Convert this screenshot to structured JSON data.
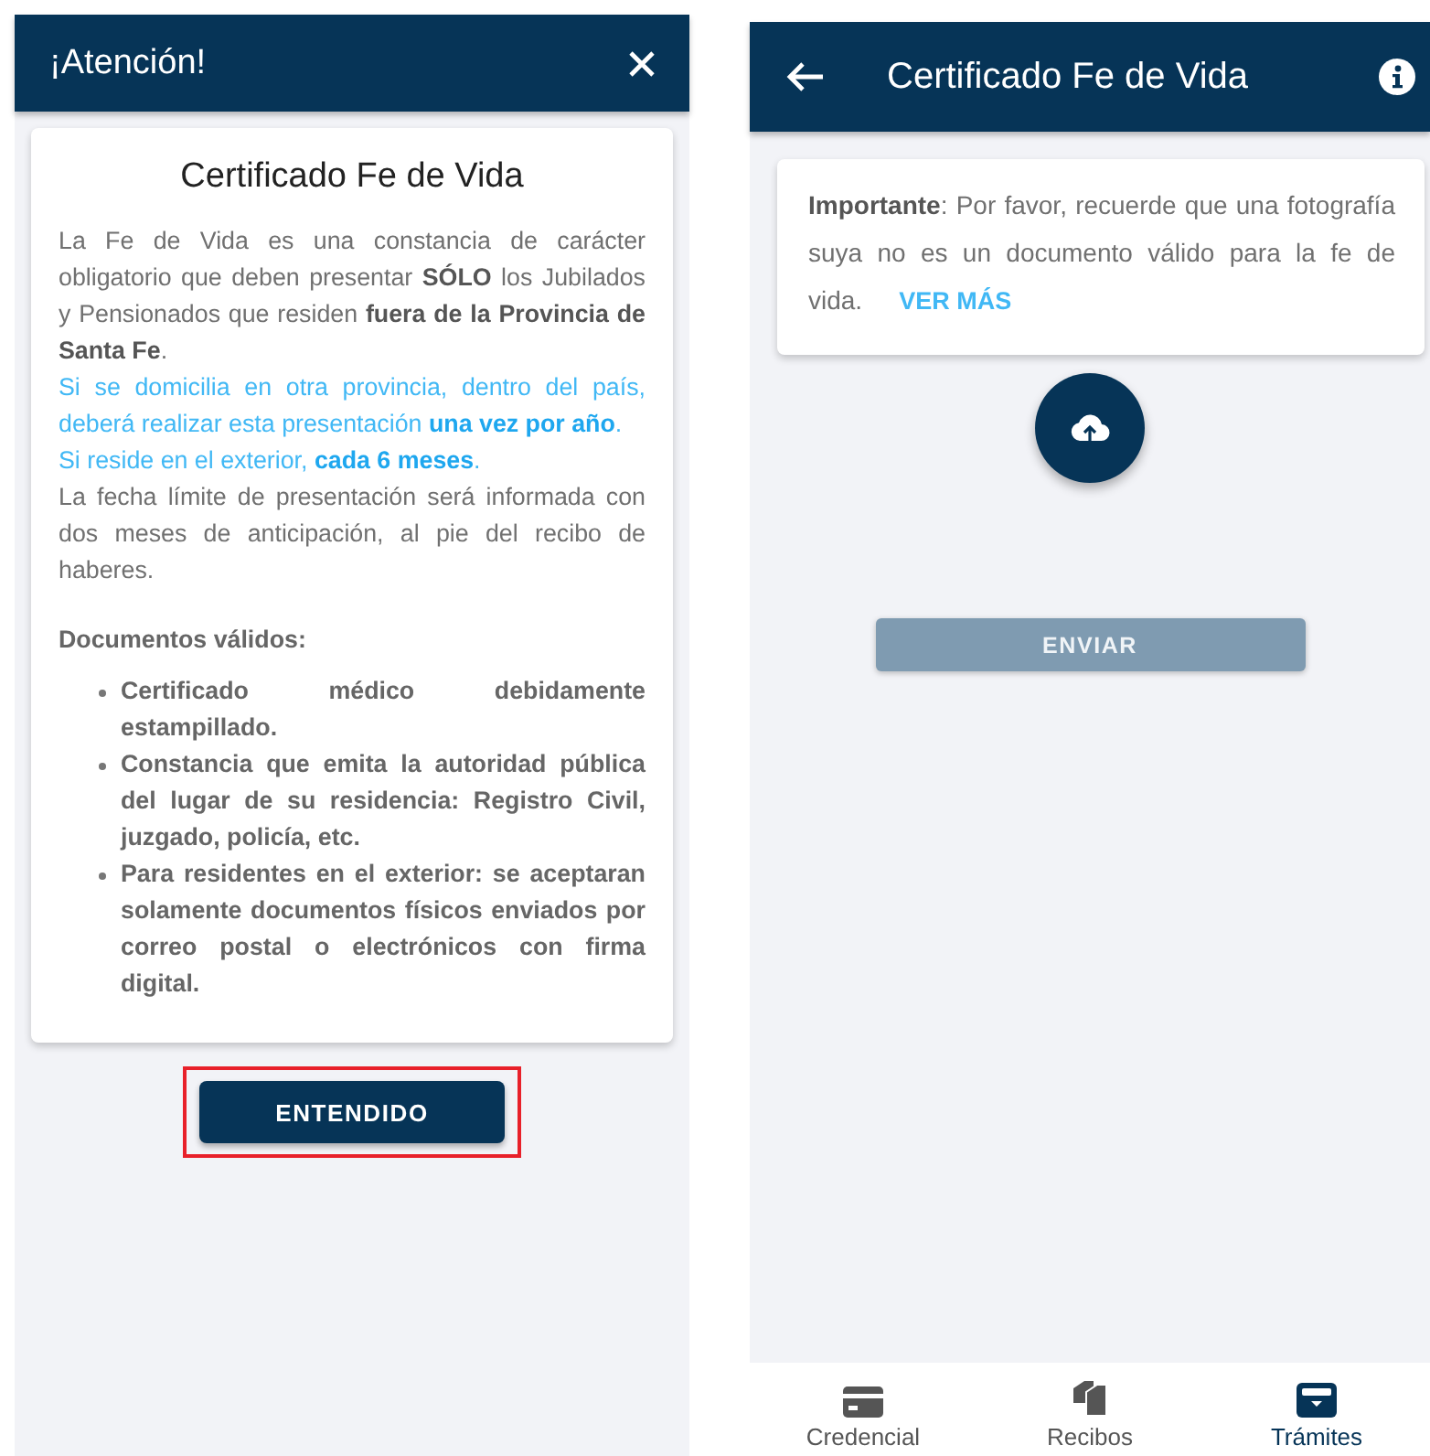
{
  "dialog": {
    "title": "¡Atención!",
    "card_title": "Certificado Fe de Vida",
    "paragraphs": [
      {
        "kind": "plain",
        "text": "La Fe de Vida es una constancia de carácter obligatorio que deben presentar **SÓLO** los Jubilados y Pensionados que residen **fuera de la Provincia de Santa Fe**."
      },
      {
        "kind": "info",
        "text": "Si se domicilia en otra provincia, dentro del país, deberá realizar esta presentación **una vez por año**."
      },
      {
        "kind": "info",
        "text": "Si reside en el exterior, **cada 6 meses**."
      },
      {
        "kind": "plain",
        "text": "La fecha límite de presentación será informada con dos meses de anticipación, al pie del recibo de haberes."
      }
    ],
    "documents_heading": "Documentos válidos:",
    "documents": [
      "Certificado médico debidamente estampillado.",
      "Constancia que emita la autoridad pública del lugar de su residencia: Registro Civil, juzgado, policía, etc.",
      "Para residentes en el exterior: se aceptaran solamente documentos físicos enviados por correo postal o electrónicos con firma digital."
    ],
    "button": {
      "label": "ENTENDIDO",
      "highlighted": true
    }
  },
  "screen": {
    "title": "Certificado Fe de Vida",
    "notice": {
      "text": "**Importante**: Por favor, recuerde que una fotografía suya no es un documento válido para la fe de vida.",
      "link": "VER MÁS"
    },
    "send_button": {
      "label": "ENVIAR",
      "disabled": true
    },
    "nav": [
      {
        "kind": "card",
        "label": "Credencial",
        "selected": false
      },
      {
        "kind": "docs",
        "label": "Recibos",
        "selected": false
      },
      {
        "kind": "inbox",
        "label": "Trámites",
        "selected": true
      }
    ]
  }
}
